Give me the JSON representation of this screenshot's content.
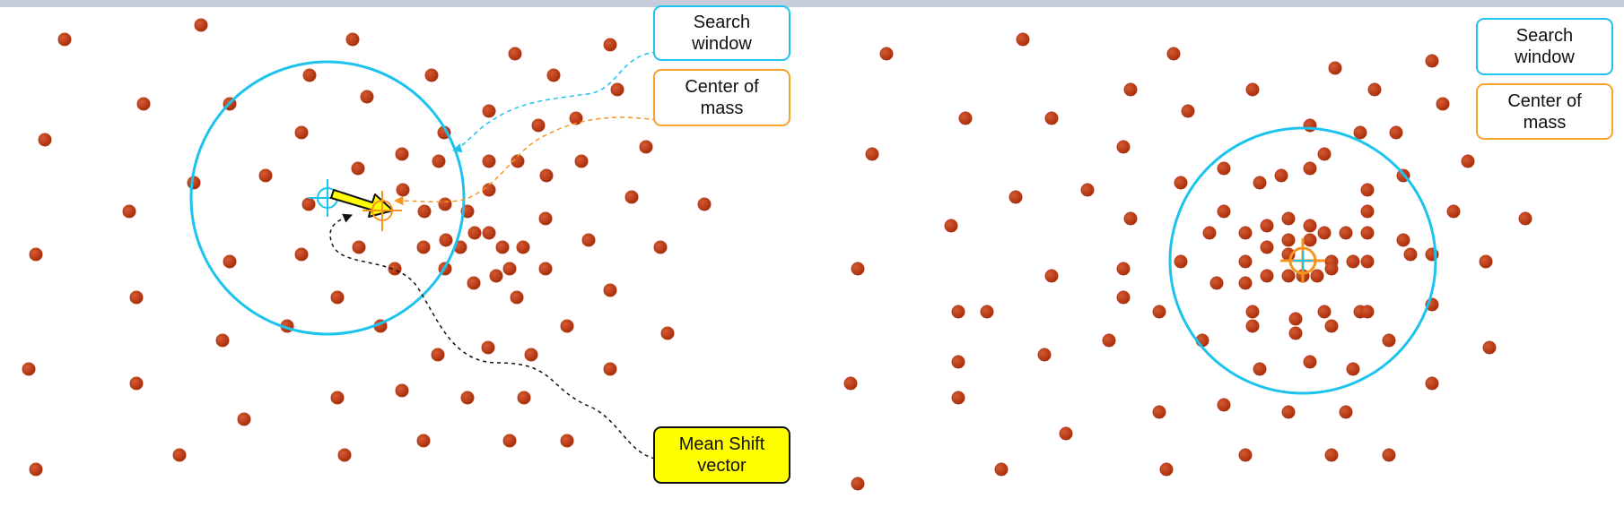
{
  "colors": {
    "point": "#a82b07",
    "point_highlight": "#d35a33",
    "search_window": "#1cc3ee",
    "center_of_mass": "#f7941d",
    "mean_shift_vector": "#ffff00",
    "label_yellow_border": "#111111"
  },
  "labels": {
    "left_search_window": "Search\nwindow",
    "left_center_of_mass": "Center of\nmass",
    "mean_shift_vector": "Mean Shift\nvector",
    "right_search_window": "Search\nwindow",
    "right_center_of_mass": "Center of\nmass"
  },
  "icons": {
    "window_center": "crosshair-icon",
    "center_of_mass": "crosshair-icon"
  }
}
